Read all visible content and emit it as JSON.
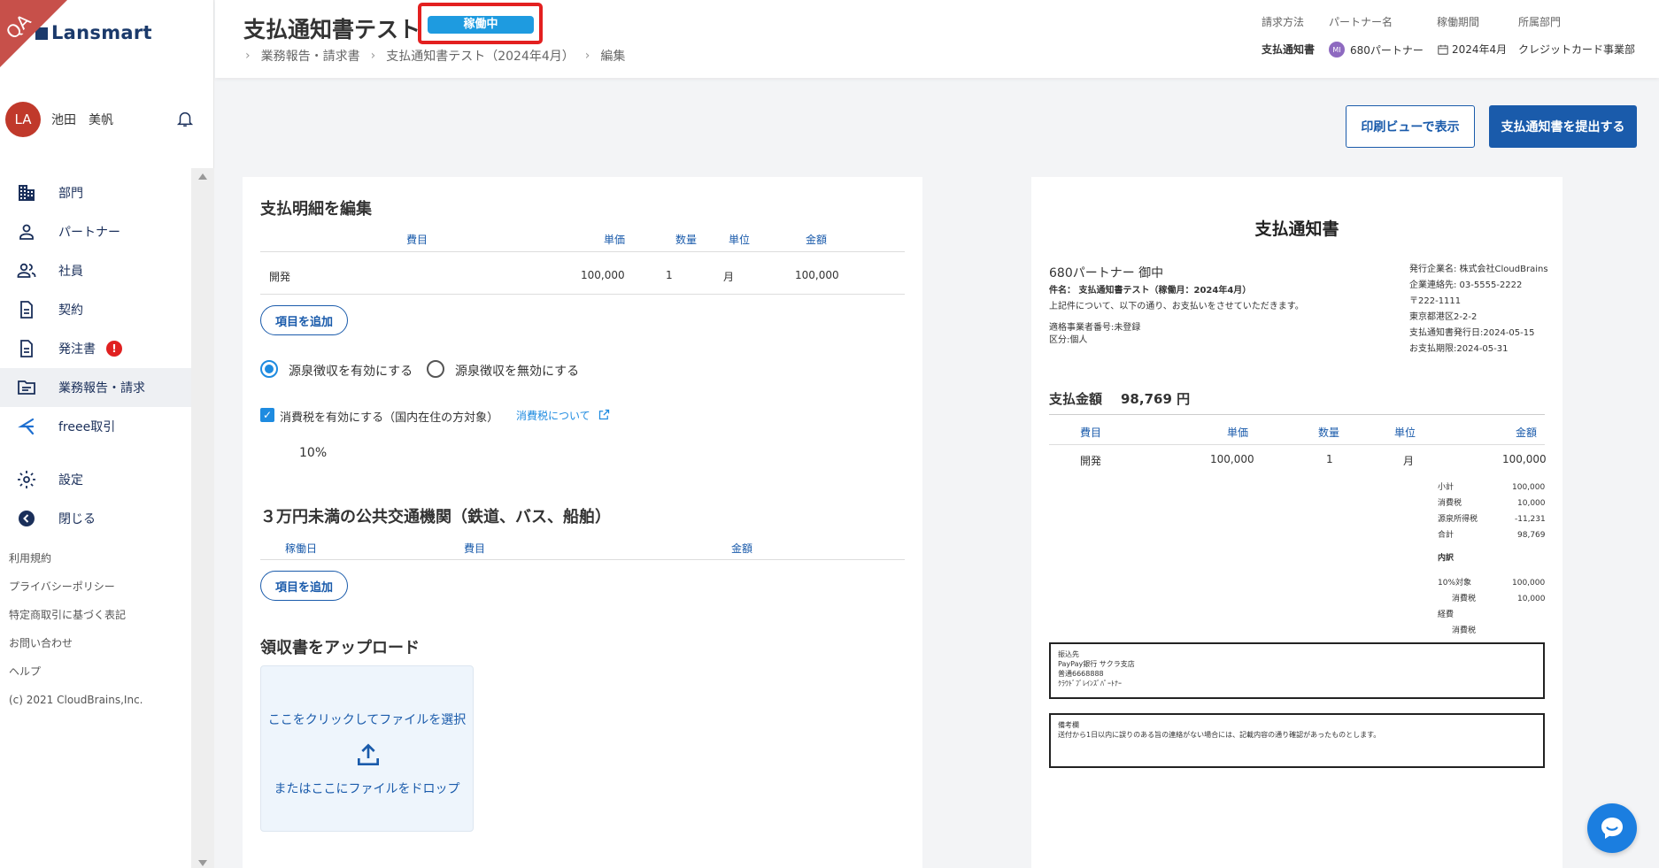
{
  "app": {
    "logo_text": "Lansmart",
    "ribbon": "QA"
  },
  "user": {
    "initials": "LA",
    "name": "池田　美帆"
  },
  "nav": {
    "items": [
      {
        "label": "部門",
        "icon": "building-icon"
      },
      {
        "label": "パートナー",
        "icon": "person-icon"
      },
      {
        "label": "社員",
        "icon": "people-icon"
      },
      {
        "label": "契約",
        "icon": "document-icon"
      },
      {
        "label": "発注書",
        "icon": "document-icon",
        "badge": "!"
      },
      {
        "label": "業務報告・請求",
        "icon": "folder-icon",
        "active": true
      },
      {
        "label": "freee取引",
        "icon": "freee-icon"
      }
    ],
    "settings": "設定",
    "close": "閉じる"
  },
  "footer_links": [
    "利用規約",
    "プライバシーポリシー",
    "特定商取引に基づく表記",
    "お問い合わせ",
    "ヘルプ",
    "(c) 2021 CloudBrains,Inc."
  ],
  "header": {
    "title": "支払通知書テスト",
    "status": "稼働中",
    "breadcrumb": [
      "業務報告・請求書",
      "支払通知書テスト（2024年4月）",
      "編集"
    ],
    "meta": {
      "method_label": "請求方法",
      "method_value": "支払通知書",
      "partner_label": "パートナー名",
      "partner_initials": "MI",
      "partner_value": "680パートナー",
      "period_label": "稼働期間",
      "period_value": "2024年4月",
      "dept_label": "所属部門",
      "dept_value": "クレジットカード事業部"
    }
  },
  "actions": {
    "print_view": "印刷ビューで表示",
    "submit": "支払通知書を提出する"
  },
  "edit": {
    "title": "支払明細を編集",
    "columns": [
      "費目",
      "単価",
      "数量",
      "単位",
      "金額"
    ],
    "rows": [
      {
        "item": "開発",
        "price": "100,000",
        "qty": "1",
        "unit": "月",
        "amount": "100,000"
      }
    ],
    "add_item": "項目を追加",
    "withholding_on": "源泉徴収を有効にする",
    "withholding_off": "源泉徴収を無効にする",
    "tax_label": "消費税を有効にする（国内在住の方対象）",
    "tax_link": "消費税について",
    "tax_rate": "10%",
    "transport_title": "３万円未満の公共交通機関（鉄道、バス、船舶）",
    "transport_columns": [
      "稼働日",
      "費目",
      "金額"
    ],
    "transport_add": "項目を追加",
    "upload_title": "領収書をアップロード",
    "upload_click": "ここをクリックしてファイルを選択",
    "upload_drop": "またはここにファイルをドロップ"
  },
  "preview": {
    "title": "支払通知書",
    "recipient": "680パートナー 御中",
    "subject": "件名： 支払通知書テスト（稼働月：2024年4月）",
    "intro": "上記件について、以下の通り、お支払いをさせていただきます。",
    "reg_no": "適格事業者番号:未登録",
    "category": "区分:個人",
    "issuer": [
      "発行企業名: 株式会社CloudBrains",
      "企業連絡先: 03-5555-2222",
      "〒222-1111",
      "東京都港区2-2-2",
      "支払通知書発行日:2024-05-15",
      "お支払期限:2024-05-31"
    ],
    "total_label": "支払金額",
    "total_value": "98,769 円",
    "columns": [
      "費目",
      "単価",
      "数量",
      "単位",
      "金額"
    ],
    "rows": [
      {
        "item": "開発",
        "price": "100,000",
        "qty": "1",
        "unit": "月",
        "amount": "100,000"
      }
    ],
    "summary": [
      {
        "label": "小計",
        "value": "100,000"
      },
      {
        "label": "消費税",
        "value": "10,000"
      },
      {
        "label": "源泉所得税",
        "value": "-11,231"
      },
      {
        "label": "合計",
        "value": "98,769"
      }
    ],
    "breakdown_title": "内訳",
    "breakdown": [
      {
        "label": "10%対象",
        "value": "100,000"
      },
      {
        "label": "消費税",
        "value": "10,000"
      },
      {
        "label": "経費",
        "value": ""
      },
      {
        "label": "消費税",
        "value": ""
      }
    ],
    "bank": [
      "振込先",
      "PayPay銀行 サクラ支店",
      "普通6668888",
      "ｸﾗｳﾄﾞﾌﾞﾚｲﾝｽﾞﾊﾟｰﾄﾅｰ"
    ],
    "remarks_label": "備考欄",
    "remarks": "送付から1日以内に誤りのある旨の連絡がない場合には、記載内容の通り確認があったものとします。"
  }
}
